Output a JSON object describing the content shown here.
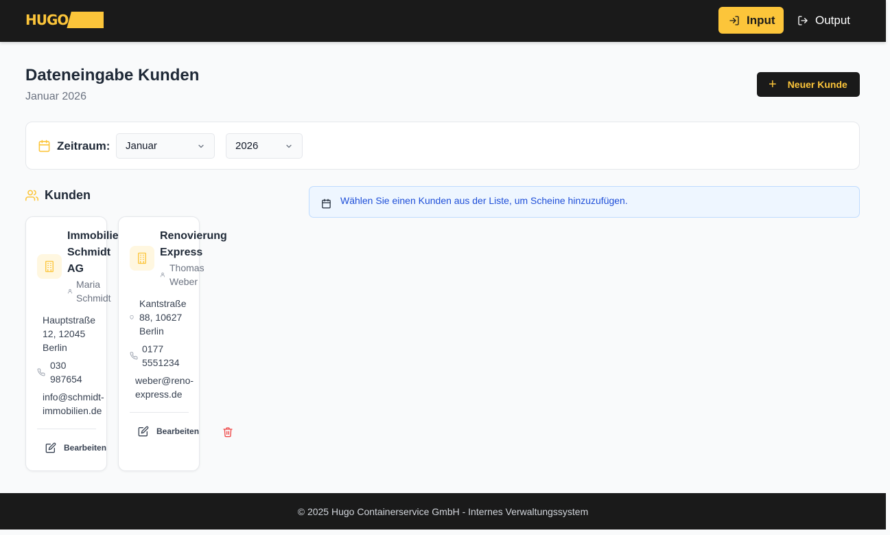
{
  "header": {
    "logo_text": "HUGO",
    "nav": {
      "input_label": "Input",
      "output_label": "Output"
    }
  },
  "page": {
    "title": "Dateneingabe Kunden",
    "subtitle": "Januar 2026",
    "new_customer_label": "Neuer Kunde"
  },
  "period": {
    "label": "Zeitraum:",
    "month_value": "Januar",
    "year_value": "2026"
  },
  "customers": {
    "section_title": "Kunden",
    "items": [
      {
        "name": "Immobilie\nSchmidt\nAG",
        "contact": "Maria\nSchmidt",
        "address": "Hauptstraße\n12, 12045\nBerlin",
        "phone": "030\n987654",
        "email": "info@schmidt-\nimmobilien.de",
        "edit_label": "Bearbeiten"
      },
      {
        "name": "Renovierung\nExpress",
        "contact": "Thomas\nWeber",
        "address": "Kantstraße\n88, 10627\nBerlin",
        "phone": "0177\n5551234",
        "email": "weber@reno-\nexpress.de",
        "edit_label": "Bearbeiten"
      }
    ]
  },
  "info": {
    "message": "Wählen Sie einen Kunden aus der Liste, um Scheine hinzuzufügen."
  },
  "footer": {
    "text": "© 2025 Hugo Containerservice GmbH - Internes Verwaltungssystem"
  },
  "colors": {
    "brand_yellow": "#fcc53a",
    "dark": "#1a1a1a",
    "info_blue": "#1d4ed8",
    "danger_red": "#ef4444"
  }
}
